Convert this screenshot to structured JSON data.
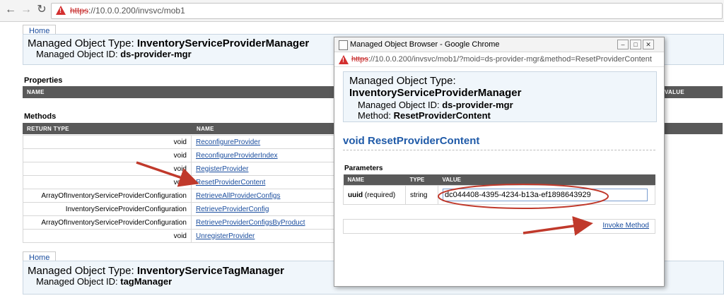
{
  "browser": {
    "url_scheme": "https",
    "url_rest": "://10.0.0.200/invsvc/mob1"
  },
  "page": {
    "home_label": "Home",
    "obj1": {
      "type_prefix": "Managed Object Type: ",
      "type_name": "InventoryServiceProviderManager",
      "id_prefix": "Managed Object ID: ",
      "id_value": "ds-provider-mgr"
    },
    "properties_heading": "Properties",
    "properties_col_name": "NAME",
    "properties_col_value": "VALUE",
    "methods_heading": "Methods",
    "methods_col_return": "RETURN TYPE",
    "methods_col_name": "NAME",
    "methods": [
      {
        "return_type": "void",
        "name": "ReconfigureProvider"
      },
      {
        "return_type": "void",
        "name": "ReconfigureProviderIndex"
      },
      {
        "return_type": "void",
        "name": "RegisterProvider"
      },
      {
        "return_type": "void",
        "name": "ResetProviderContent"
      },
      {
        "return_type": "ArrayOfInventoryServiceProviderConfiguration",
        "name": "RetrieveAllProviderConfigs"
      },
      {
        "return_type": "InventoryServiceProviderConfiguration",
        "name": "RetrieveProviderConfig"
      },
      {
        "return_type": "ArrayOfInventoryServiceProviderConfiguration",
        "name": "RetrieveProviderConfigsByProduct"
      },
      {
        "return_type": "void",
        "name": "UnregisterProvider"
      }
    ],
    "home2_label": "Home",
    "obj2": {
      "type_prefix": "Managed Object Type: ",
      "type_name": "InventoryServiceTagManager",
      "id_prefix": "Managed Object ID: ",
      "id_value": "tagManager"
    }
  },
  "popup": {
    "window_title": "Managed Object Browser - Google Chrome",
    "url_scheme": "https",
    "url_rest": "://10.0.0.200/invsvc/mob1/?moid=ds-provider-mgr&method=ResetProviderContent",
    "type_prefix": "Managed Object Type:",
    "type_name": "InventoryServiceProviderManager",
    "id_prefix": "Managed Object ID: ",
    "id_value": "ds-provider-mgr",
    "method_prefix": "Method: ",
    "method_value": "ResetProviderContent",
    "method_heading": "void ResetProviderContent",
    "parameters_heading": "Parameters",
    "col_name": "NAME",
    "col_type": "TYPE",
    "col_value": "VALUE",
    "param_name": "uuid",
    "param_required": " (required)",
    "param_type": "string",
    "param_value": "dc044408-4395-4234-b13a-ef1898643929",
    "invoke_label": "Invoke Method"
  },
  "colors": {
    "link": "#1a4d9e",
    "header_bar": "#595959",
    "annotation_red": "#c0392b"
  }
}
